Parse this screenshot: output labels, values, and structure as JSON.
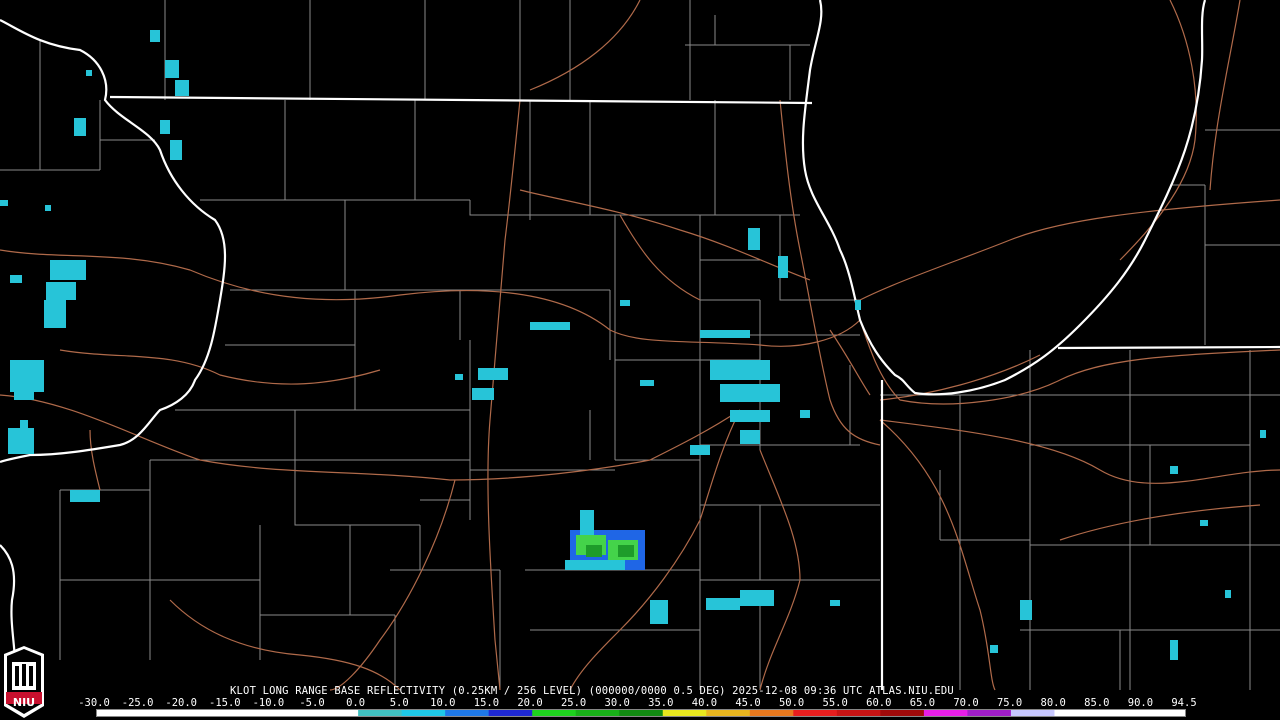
{
  "map": {
    "background": "#000000",
    "boundary_color": "#ffffff",
    "county_color": "#8a8a8a",
    "highway_color": "#b06a4a",
    "lake_label": "",
    "reflectivity_colors": {
      "cyan": "#27c4d8",
      "blue": "#1f66e6",
      "light_green": "#44d34a",
      "dark_green": "#1e9c2a"
    }
  },
  "caption": "KLOT LONG RANGE BASE REFLECTIVITY (0.25KM / 256 LEVEL) (000000/0000 0.5 DEG) 2025-12-08 09:36 UTC  ATLAS.NIU.EDU",
  "scale": {
    "ticks": [
      "-30.0",
      "-25.0",
      "-20.0",
      "-15.0",
      "-10.0",
      "-5.0",
      "0.0",
      "5.0",
      "10.0",
      "15.0",
      "20.0",
      "25.0",
      "30.0",
      "35.0",
      "40.0",
      "45.0",
      "50.0",
      "55.0",
      "60.0",
      "65.0",
      "70.0",
      "75.0",
      "80.0",
      "85.0",
      "90.0",
      "94.5"
    ],
    "colors": [
      "#ffffff",
      "#ffffff",
      "#ffffff",
      "#ffffff",
      "#ffffff",
      "#ffffff",
      "#40c0c0",
      "#1ec8e6",
      "#1e78e6",
      "#1e28d2",
      "#1ed21e",
      "#18b018",
      "#128a12",
      "#e6e61e",
      "#e6b41e",
      "#e6781e",
      "#e61e1e",
      "#c81414",
      "#a00a0a",
      "#e61ee6",
      "#a01ec8",
      "#c8c8ff",
      "#ffffff",
      "#ffffff",
      "#ffffff"
    ]
  },
  "logo": {
    "text": "NIU",
    "color": "#c8102e"
  }
}
